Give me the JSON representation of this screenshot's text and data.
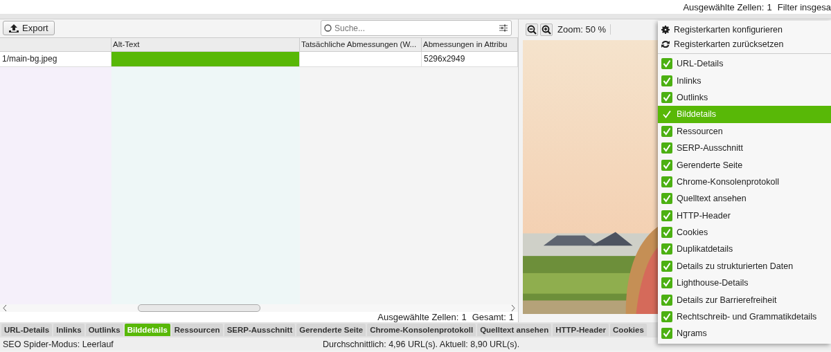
{
  "top_status": {
    "selected_label": "Ausgewählte Zellen:",
    "selected_count": "1",
    "filter_label": "Filter insgesa"
  },
  "toolbar": {
    "export_button": "Export",
    "search": {
      "placeholder": "Suche..."
    }
  },
  "table": {
    "columns": [
      {},
      {
        "label": "Alt-Text"
      },
      {
        "label": "Tatsächliche Abmessungen (W..."
      },
      {
        "label": "Abmessungen in Attribu"
      }
    ],
    "rows": [
      {
        "cells": [
          {
            "text": "1/main-bg.jpeg",
            "highlighted": false
          },
          {
            "highlighted": true
          },
          {
            "highlighted": false
          },
          {
            "text": "5296x2949",
            "highlighted": false
          }
        ]
      }
    ]
  },
  "table_status": {
    "selected_label": "Ausgewählte Zellen:",
    "selected_count": "1",
    "total_label": "Gesamt:",
    "total_count": "1"
  },
  "preview": {
    "zoom_label": "Zoom: 50 %"
  },
  "menu": {
    "items": [
      {
        "kind": "action",
        "label": "Registerkarten konfigurieren"
      },
      {
        "kind": "action",
        "label": "Registerkarten zurücksetzen"
      },
      {
        "kind": "check",
        "label": "URL-Details",
        "checked": true,
        "selected": false
      },
      {
        "kind": "check",
        "label": "Inlinks",
        "checked": true,
        "selected": false
      },
      {
        "kind": "check",
        "label": "Outlinks",
        "checked": true,
        "selected": false
      },
      {
        "kind": "check",
        "label": "Bilddetails",
        "checked": true,
        "selected": true
      },
      {
        "kind": "check",
        "label": "Ressourcen",
        "checked": true,
        "selected": false
      },
      {
        "kind": "check",
        "label": "SERP-Ausschnitt",
        "checked": true,
        "selected": false
      },
      {
        "kind": "check",
        "label": "Gerenderte Seite",
        "checked": true,
        "selected": false
      },
      {
        "kind": "check",
        "label": "Chrome-Konsolenprotokoll",
        "checked": true,
        "selected": false
      },
      {
        "kind": "check",
        "label": "Quelltext ansehen",
        "checked": true,
        "selected": false
      },
      {
        "kind": "check",
        "label": "HTTP-Header",
        "checked": true,
        "selected": false
      },
      {
        "kind": "check",
        "label": "Cookies",
        "checked": true,
        "selected": false
      },
      {
        "kind": "check",
        "label": "Duplikatdetails",
        "checked": true,
        "selected": false
      },
      {
        "kind": "check",
        "label": "Details zu strukturierten Daten",
        "checked": true,
        "selected": false
      },
      {
        "kind": "check",
        "label": "Lighthouse-Details",
        "checked": true,
        "selected": false
      },
      {
        "kind": "check",
        "label": "Details zur Barrierefreiheit",
        "checked": true,
        "selected": false
      },
      {
        "kind": "check",
        "label": "Rechtschreib- und Grammatikdetails",
        "checked": true,
        "selected": false
      },
      {
        "kind": "check",
        "label": "Ngrams",
        "checked": true,
        "selected": false
      }
    ]
  },
  "tabs": [
    {
      "label": "URL-Details",
      "selected": false
    },
    {
      "label": "Inlinks",
      "selected": false
    },
    {
      "label": "Outlinks",
      "selected": false
    },
    {
      "label": "Bilddetails",
      "selected": true
    },
    {
      "label": "Ressourcen",
      "selected": false
    },
    {
      "label": "SERP-Ausschnitt",
      "selected": false
    },
    {
      "label": "Gerenderte Seite",
      "selected": false
    },
    {
      "label": "Chrome-Konsolenprotokoll",
      "selected": false
    },
    {
      "label": "Quelltext ansehen",
      "selected": false
    },
    {
      "label": "HTTP-Header",
      "selected": false
    },
    {
      "label": "Cookies",
      "selected": false
    }
  ],
  "status_bar": {
    "mode": "SEO Spider-Modus: Leerlauf",
    "speed": "Durchschnittlich: 4,96 URL(s). Aktuell: 8,90 URL(s)."
  }
}
